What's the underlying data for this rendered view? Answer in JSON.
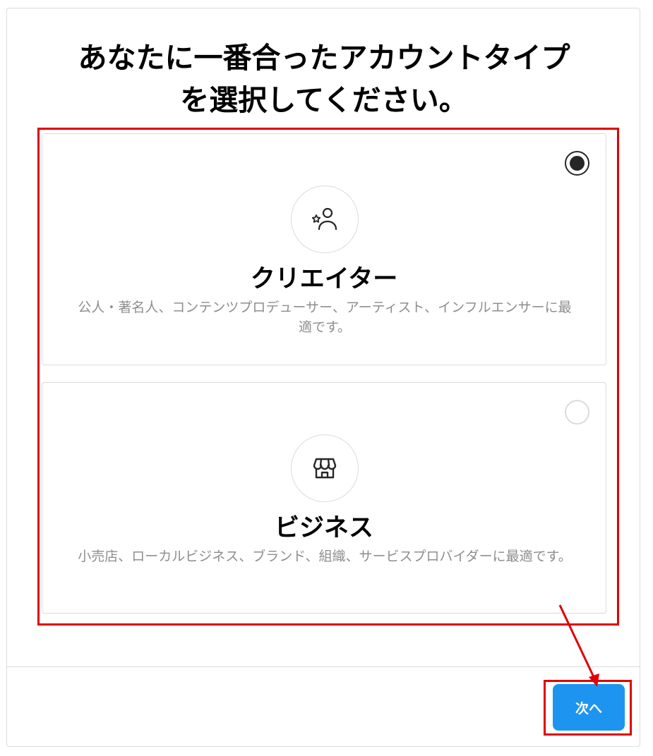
{
  "page": {
    "title_lines": [
      "あなたに一番合ったアカウントタイプ",
      "を選択してください。"
    ]
  },
  "options": [
    {
      "title": "クリエイター",
      "description": "公人・著名人、コンテンツプロデューサー、アーティスト、インフルエンサーに最適です。",
      "selected": true,
      "icon": "creator-star-person-icon"
    },
    {
      "title": "ビジネス",
      "description": "小売店、ローカルビジネス、ブランド、組織、サービスプロバイダーに最適です。",
      "selected": false,
      "icon": "storefront-icon"
    }
  ],
  "footer": {
    "next_label": "次へ"
  },
  "colors": {
    "annotation_red": "#e00000",
    "primary_blue": "#1d95f0",
    "border_gray": "#dbdbdb",
    "secondary_text": "#8e8e8e"
  }
}
